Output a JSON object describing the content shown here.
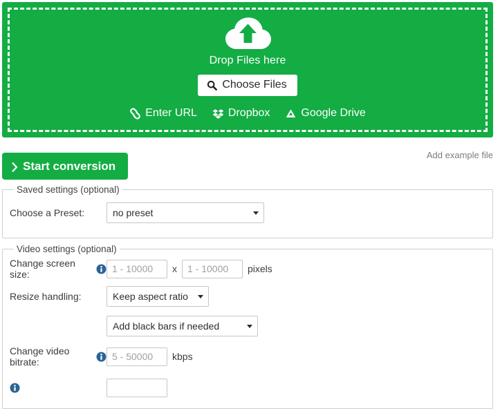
{
  "dropzone": {
    "cloud_icon": "cloud-upload-icon",
    "drop_text": "Drop Files here",
    "choose_files_label": "Choose Files",
    "choose_files_icon": "search-icon",
    "services": [
      {
        "label": "Enter URL",
        "icon": "link-icon"
      },
      {
        "label": "Dropbox",
        "icon": "dropbox-icon"
      },
      {
        "label": "Google Drive",
        "icon": "google-drive-icon"
      }
    ],
    "background_color": "#13ad43",
    "border_style": "dashed-white"
  },
  "actions": {
    "start_conversion_label": "Start conversion",
    "start_conversion_icon": "chevron-right-icon",
    "add_example_file_label": "Add example file"
  },
  "saved_settings": {
    "legend": "Saved settings (optional)",
    "preset_label": "Choose a Preset:",
    "preset_value": "no preset",
    "preset_options": [
      "no preset"
    ]
  },
  "video_settings": {
    "legend": "Video settings (optional)",
    "screen_size": {
      "label": "Change screen size:",
      "info_icon": "info-icon",
      "width_placeholder": "1 - 10000",
      "width_value": "",
      "separator": "x",
      "height_placeholder": "1 - 10000",
      "height_value": "",
      "unit": "pixels"
    },
    "resize_handling": {
      "label": "Resize handling:",
      "mode_value": "Keep aspect ratio",
      "mode_options": [
        "Keep aspect ratio"
      ],
      "fill_value": "Add black bars if needed",
      "fill_options": [
        "Add black bars if needed"
      ]
    },
    "video_bitrate": {
      "label": "Change video bitrate:",
      "info_icon": "info-icon",
      "placeholder": "5 - 50000",
      "value": "",
      "unit": "kbps"
    }
  },
  "colors": {
    "brand_green": "#13ad43",
    "info_blue": "#2a6496",
    "border_gray": "#cfcfcf"
  }
}
